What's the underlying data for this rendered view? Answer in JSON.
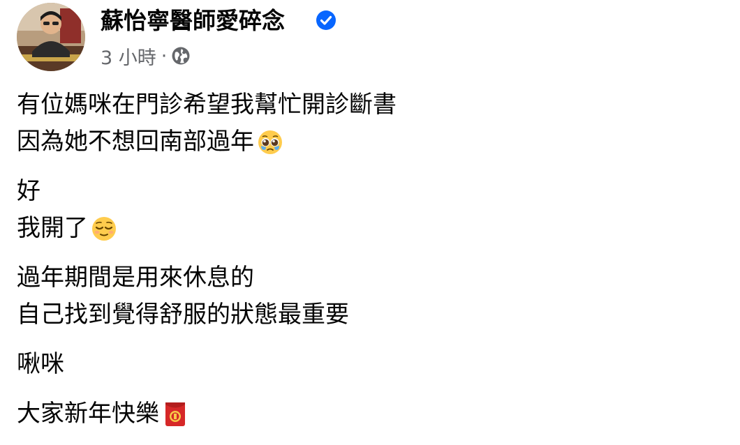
{
  "post": {
    "author": {
      "name": "蘇怡寧醫師愛碎念",
      "verified": true
    },
    "meta": {
      "time": "3 小時",
      "separator": "·",
      "audience_icon": "globe-icon"
    },
    "paragraphs": [
      {
        "lines": [
          {
            "text": "有位媽咪在門診希望我幫忙開診斷書"
          },
          {
            "text": "因為她不想回南部過年",
            "emoji": "pleading-face-emoji"
          }
        ]
      },
      {
        "lines": [
          {
            "text": "好"
          },
          {
            "text": "我開了",
            "emoji": "relieved-face-emoji"
          }
        ]
      },
      {
        "lines": [
          {
            "text": "過年期間是用來休息的"
          },
          {
            "text": "自己找到覺得舒服的狀態最重要"
          }
        ]
      },
      {
        "lines": [
          {
            "text": "啾咪"
          }
        ]
      },
      {
        "lines": [
          {
            "text": "大家新年快樂",
            "emoji": "red-envelope-emoji"
          }
        ]
      }
    ]
  },
  "colors": {
    "verified_blue": "#0866ff",
    "meta_gray": "#65676b",
    "text": "#050505",
    "envelope_red": "#d62828",
    "emoji_yellow": "#ffcc4d"
  }
}
